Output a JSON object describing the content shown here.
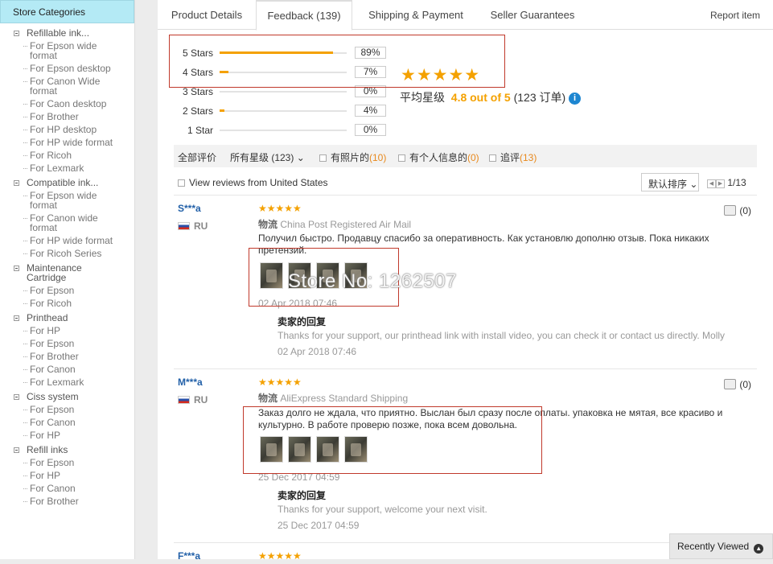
{
  "sidebar": {
    "title": "Store Categories",
    "groups": [
      {
        "label": "Refillable ink...",
        "items": [
          [
            "For Epson wide",
            "format"
          ],
          [
            "For Epson desktop"
          ],
          [
            "For Canon Wide",
            "format"
          ],
          [
            "For Caon desktop"
          ],
          [
            "For Brother"
          ],
          [
            "For HP desktop"
          ],
          [
            "For HP wide format"
          ],
          [
            "For Ricoh"
          ],
          [
            "For Lexmark"
          ]
        ]
      },
      {
        "label": "Compatible ink...",
        "items": [
          [
            "For Epson wide",
            "format"
          ],
          [
            "For Canon wide",
            "format"
          ],
          [
            "For HP wide format"
          ],
          [
            "For Ricoh Series"
          ]
        ]
      },
      {
        "label": [
          "Maintenance",
          "Cartridge"
        ],
        "items": [
          [
            "For Epson"
          ],
          [
            "For Ricoh"
          ]
        ]
      },
      {
        "label": "Printhead",
        "items": [
          [
            "For HP"
          ],
          [
            "For Epson"
          ],
          [
            "For Brother"
          ],
          [
            "For Canon"
          ],
          [
            "For Lexmark"
          ]
        ]
      },
      {
        "label": "Ciss system",
        "items": [
          [
            "For Epson"
          ],
          [
            "For Canon"
          ],
          [
            "For HP"
          ]
        ]
      },
      {
        "label": "Refill inks",
        "items": [
          [
            "For Epson"
          ],
          [
            "For HP"
          ],
          [
            "For Canon"
          ],
          [
            "For Brother"
          ]
        ]
      }
    ]
  },
  "tabs": {
    "items": [
      "Product Details",
      "Feedback (139)",
      "Shipping & Payment",
      "Seller Guarantees"
    ],
    "active": 1,
    "report": "Report item"
  },
  "ratings": {
    "rows": [
      {
        "label": "5 Stars",
        "pct": "89%",
        "value": 0.89
      },
      {
        "label": "4 Stars",
        "pct": "7%",
        "value": 0.07
      },
      {
        "label": "3 Stars",
        "pct": "0%",
        "value": 0
      },
      {
        "label": "2 Stars",
        "pct": "4%",
        "value": 0.04
      },
      {
        "label": "1 Star",
        "pct": "0%",
        "value": 0
      }
    ],
    "stars": "★★★★★",
    "avg_prefix": "平均星级",
    "avg_score": "4.8 out of 5",
    "avg_suffix": "(123 订单)",
    "info_icon": "i"
  },
  "filter": {
    "all": "全部评价",
    "stars": "所有星级 (123)",
    "caret": "⌄",
    "photos": "有照片的",
    "photos_n": "(10)",
    "personal": "有个人信息的",
    "personal_n": "(0)",
    "followup": "追评",
    "followup_n": "(13)"
  },
  "view_us": "View reviews from United States",
  "sort": {
    "label": "默认排序",
    "caret": "⌄"
  },
  "pager": {
    "prev": "◀",
    "next": "▶",
    "pages": "1/13"
  },
  "reviews": [
    {
      "user": "S***a",
      "country": "RU",
      "stars": "★★★★★",
      "ship_label": "物流",
      "ship": "China Post Registered Air Mail",
      "text": "Получил быстро. Продавцу спасибо за оперативность. Как установлю дополню отзыв. Пока никаких претензий.",
      "date": "02 Apr 2018 07:46",
      "reply_title": "卖家的回复",
      "reply": "Thanks for your support, our printhead link with install video, you can check it or contact us directly. Molly",
      "reply_date": "02 Apr 2018 07:46",
      "likes": "(0)"
    },
    {
      "user": "M***a",
      "country": "RU",
      "stars": "★★★★★",
      "ship_label": "物流",
      "ship": "AliExpress Standard Shipping",
      "text": "Заказ долго не ждала, что приятно. Выслан был сразу после оплаты. упаковка не мятая, все красиво и культурно. В работе проверю позже, пока всем довольна.",
      "date": "25 Dec 2017 04:59",
      "reply_title": "卖家的回复",
      "reply": "Thanks for your support, welcome your next visit.",
      "reply_date": "25 Dec 2017 04:59",
      "likes": "(0)"
    },
    {
      "user": "F***a",
      "stars": "★★★★★"
    }
  ],
  "watermark": "Store No: 1262507",
  "recent": "Recently Viewed",
  "colors": {
    "accent": "#f4a100",
    "link": "#2260a8",
    "highlight_box": "#c0392b",
    "sidebar_head": "#b4eaf5"
  }
}
